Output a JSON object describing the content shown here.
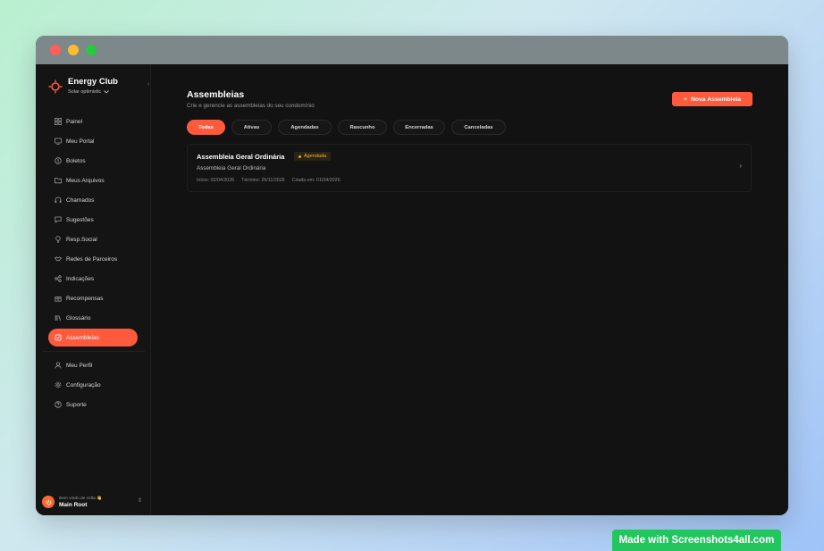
{
  "brand": {
    "name": "Energy Club",
    "subtitle": "Solar optimistic",
    "accent": "#ff5a3c"
  },
  "sidebar": {
    "collapse_glyph": "‹",
    "items": [
      {
        "label": "Painel",
        "icon": "grid-icon"
      },
      {
        "label": "Meu Portal",
        "icon": "monitor-icon"
      },
      {
        "label": "Boletos",
        "icon": "receipt-icon"
      },
      {
        "label": "Meus Arquivos",
        "icon": "folder-icon"
      },
      {
        "label": "Chamados",
        "icon": "headset-icon"
      },
      {
        "label": "Sugestões",
        "icon": "chat-icon"
      },
      {
        "label": "Resp.Social",
        "icon": "bulb-icon"
      },
      {
        "label": "Redes de Parceiros",
        "icon": "handshake-icon"
      },
      {
        "label": "Indicações",
        "icon": "share-icon"
      },
      {
        "label": "Recompensas",
        "icon": "gift-icon"
      },
      {
        "label": "Glossário",
        "icon": "book-icon"
      },
      {
        "label": "Assembleias",
        "icon": "ballot-icon",
        "active": true
      }
    ],
    "secondary_items": [
      {
        "label": "Meu Perfil",
        "icon": "user-icon"
      },
      {
        "label": "Configuração",
        "icon": "gear-icon"
      },
      {
        "label": "Suporte",
        "icon": "help-icon"
      }
    ],
    "user": {
      "welcome": "Bem vindo de volta 👋",
      "name": "Main Root"
    }
  },
  "main": {
    "title": "Assembleias",
    "subtitle": "Crie e gerencie as assembleias do seu condomínio",
    "new_button": "Nova Assembleia",
    "tabs": [
      "Todas",
      "Ativas",
      "Agendadas",
      "Rascunho",
      "Encerradas",
      "Canceladas"
    ],
    "active_tab": "Todas",
    "assemblies": [
      {
        "title": "Assembleia Geral Ordinária",
        "status": "Agendada",
        "status_color": "#f0a020",
        "description": "Assembleia Geral Ordinária",
        "start": "Início: 02/04/2026",
        "end": "Término: 26/11/2026",
        "created": "Criada em: 01/04/2026"
      }
    ]
  },
  "watermark": "Made with Screenshots4all.com"
}
